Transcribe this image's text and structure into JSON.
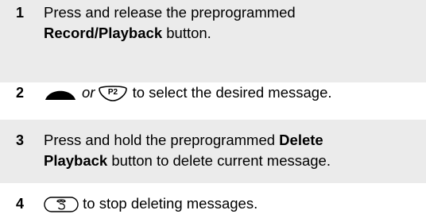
{
  "steps": [
    {
      "number": "1",
      "line1": "Press and release the preprogrammed",
      "line2_bold": "Record/Playback",
      "line2_rest": " button."
    },
    {
      "number": "2",
      "or_word": "or",
      "p2_label": "P2",
      "rest": "to select the desired message."
    },
    {
      "number": "3",
      "line1_plain": "Press and hold the preprogrammed ",
      "line1_bold": "Delete",
      "line2_bold": "Playback",
      "line2_rest": " button to delete current message."
    },
    {
      "number": "4",
      "rest": "to stop deleting messages."
    }
  ],
  "icons": {
    "up_key": "up-arrow-key-icon",
    "p2_key": "p2-key-icon",
    "end_key": "end-call-key-icon"
  }
}
